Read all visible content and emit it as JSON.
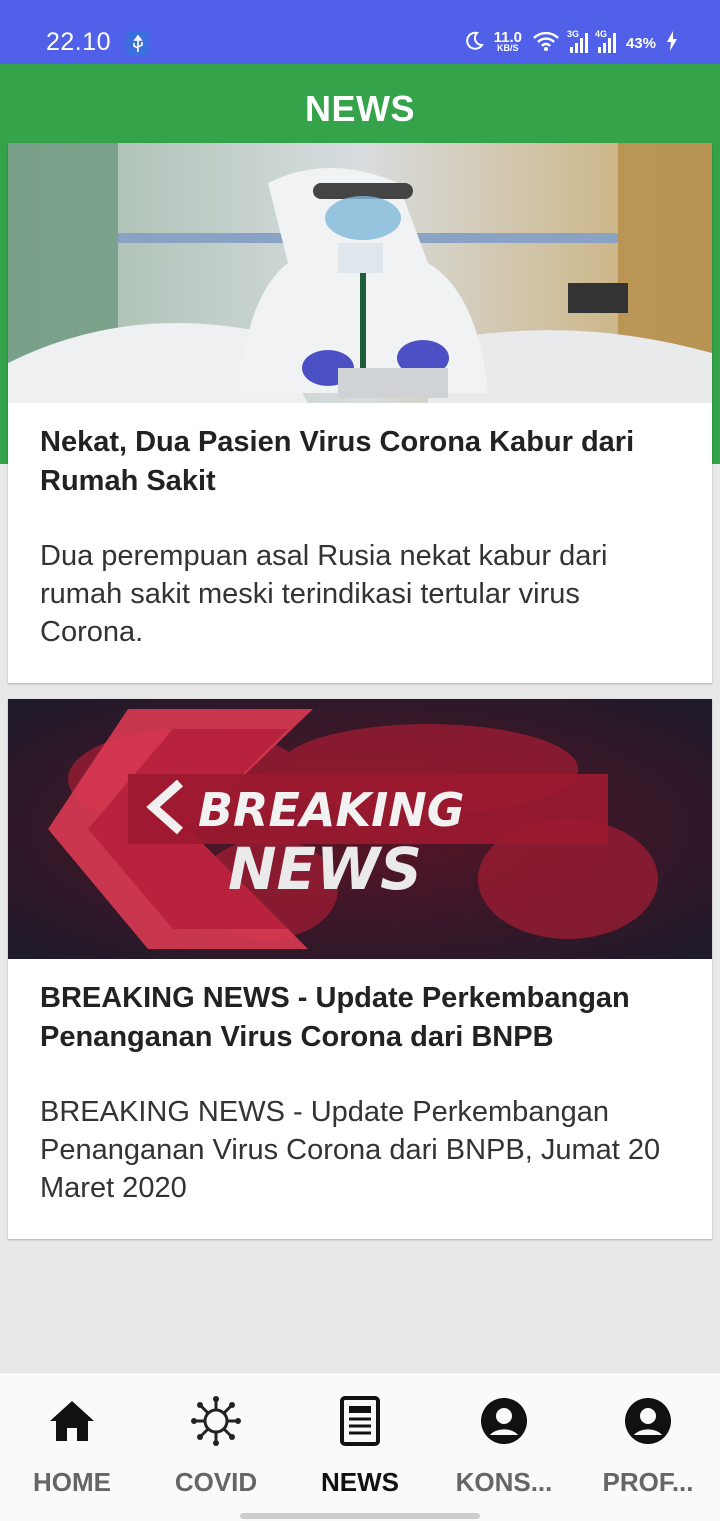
{
  "status_bar": {
    "time": "22.10",
    "net_speed_value": "11.0",
    "net_speed_unit": "KB/S",
    "sig1_tag": "3G",
    "sig2_tag": "4G",
    "battery": "43%"
  },
  "header": {
    "title": "NEWS"
  },
  "articles": [
    {
      "title": "Nekat, Dua Pasien Virus Corona Kabur dari Rumah Sakit",
      "description": "Dua perempuan asal Rusia nekat kabur dari rumah sakit meski terindikasi tertular virus Corona.",
      "image_icon": "hospital-photo"
    },
    {
      "title": "BREAKING NEWS - Update Perkembangan Penanganan Virus Corona dari BNPB",
      "description": "BREAKING NEWS - Update Perkembangan Penanganan Virus Corona dari BNPB, Jumat 20 Maret 2020",
      "image_icon": "breaking-news-graphic",
      "image_text_1": "BREAKING",
      "image_text_2": "NEWS"
    }
  ],
  "bottom_nav": [
    {
      "label": "HOME",
      "icon": "home-icon",
      "active": false
    },
    {
      "label": "COVID",
      "icon": "virus-icon",
      "active": false
    },
    {
      "label": "NEWS",
      "icon": "newspaper-icon",
      "active": true
    },
    {
      "label": "KONS...",
      "icon": "user-icon",
      "active": false
    },
    {
      "label": "PROF...",
      "icon": "user-icon",
      "active": false
    }
  ],
  "colors": {
    "status_bar": "#5160e8",
    "header": "#34a34a",
    "background": "#e8e8e8"
  }
}
